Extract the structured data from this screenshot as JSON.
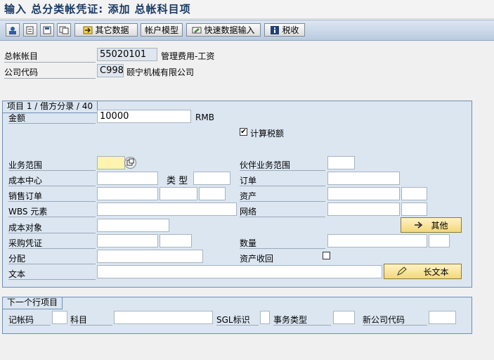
{
  "title": "输入 总分类帐凭证: 添加 总帐科目项",
  "toolbar": {
    "other_data": "其它数据",
    "account_model": "帐户模型",
    "fast_entry": "快速数据输入",
    "tax": "税收"
  },
  "header": {
    "gl_account_label": "总帐帐目",
    "gl_account_value": "55020101",
    "gl_account_desc": "管理费用-工资",
    "company_code_label": "公司代码",
    "company_code_value": "C998",
    "company_code_desc": "颐宁机械有限公司"
  },
  "item": {
    "group_title": "项目 1 / 借方分录 / 40",
    "amount_label": "金额",
    "amount_value": "10000",
    "currency": "RMB",
    "calc_tax_label": "计算税额",
    "calc_tax_checked": true,
    "business_area_label": "业务范围",
    "partner_ba_label": "伙伴业务范围",
    "cost_center_label": "成本中心",
    "type_label": "类 型",
    "order_label": "订单",
    "sales_order_label": "销售订单",
    "asset_label": "资产",
    "wbs_label": "WBS 元素",
    "network_label": "网络",
    "cost_object_label": "成本对象",
    "more_button": "其他",
    "po_label": "采购凭证",
    "quantity_label": "数量",
    "assignment_label": "分配",
    "asset_retirement_label": "资产收回",
    "text_label": "文本",
    "long_text_button": "长文本"
  },
  "next_item": {
    "group_title": "下一个行项目",
    "posting_key_label": "记帐码",
    "account_label": "科目",
    "sgl_label": "SGL标识",
    "trans_type_label": "事务类型",
    "new_company_label": "新公司代码"
  }
}
